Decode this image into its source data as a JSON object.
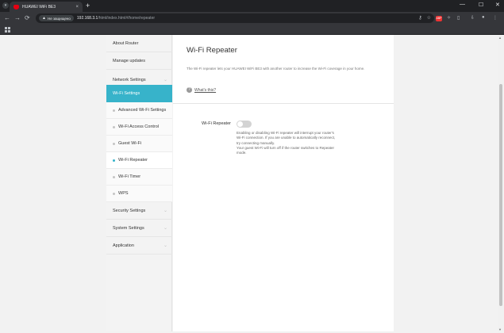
{
  "browser": {
    "tab_title": "HUAWEI WiFi BE3",
    "tab_close": "×",
    "new_tab": "+",
    "security_label": "Не защищено",
    "security_icon": "warning-icon",
    "url_host": "192.168.3.1",
    "url_path": "/html/index.html#/home/repeater",
    "back": "←",
    "forward": "→",
    "reload": "⟳",
    "window_minimize": "—",
    "window_maximize": "☐",
    "window_close": "✕"
  },
  "sidebar": {
    "items": [
      {
        "label": "About Router",
        "expandable": false
      },
      {
        "label": "Manage updates",
        "expandable": false
      },
      {
        "label": "Network Settings",
        "expandable": true
      },
      {
        "label": "Wi-Fi Settings",
        "expandable": true,
        "active": true
      },
      {
        "label": "Security Settings",
        "expandable": true
      },
      {
        "label": "System Settings",
        "expandable": true
      },
      {
        "label": "Application",
        "expandable": true
      }
    ],
    "wifi_sub_items": [
      {
        "label": "Advanced Wi-Fi Settings"
      },
      {
        "label": "Wi-Fi Access Control"
      },
      {
        "label": "Guest Wi-Fi"
      },
      {
        "label": "Wi-Fi Repeater",
        "active": true
      },
      {
        "label": "Wi-Fi Timer"
      },
      {
        "label": "WPS"
      }
    ]
  },
  "main": {
    "title": "Wi-Fi Repeater",
    "description": "The Wi-Fi repeater lets your HUAWEI WiFi BE3 with another router to increase the Wi-Fi coverage in your home.",
    "help_link": "What's this?",
    "help_icon": "?",
    "setting": {
      "label": "Wi-Fi Repeater",
      "enabled": false,
      "note_lines": [
        "Enabling or disabling Wi-Fi repeater will interrupt your router's",
        "Wi-Fi connection. If you are unable to automatically reconnect,",
        "try connecting manually.",
        "Your guest Wi-Fi will turn off if the router switches to Repeater",
        "mode."
      ]
    }
  },
  "colors": {
    "accent": "#37b3ca",
    "brand_red": "#e60012"
  }
}
